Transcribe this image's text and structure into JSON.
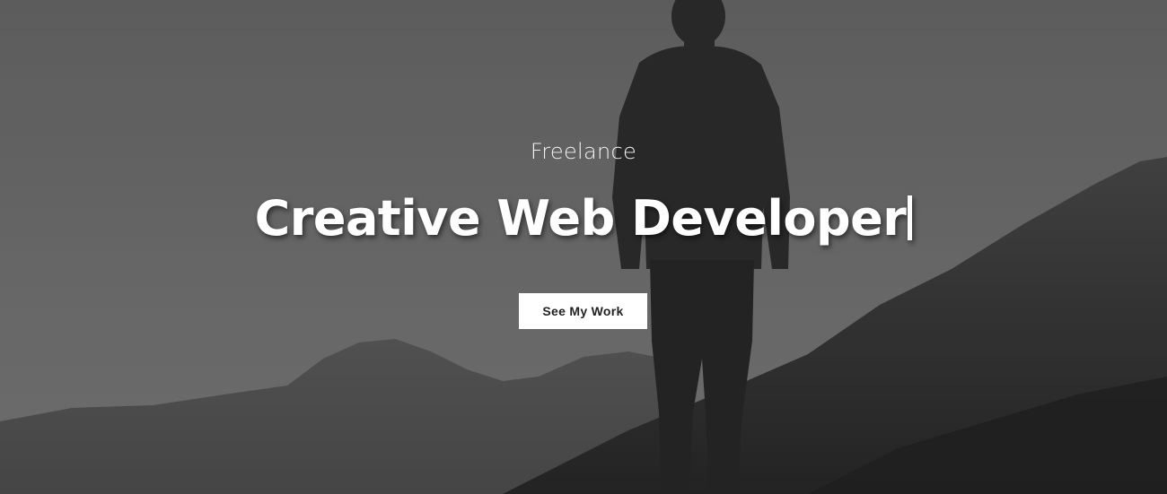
{
  "hero": {
    "subtitle": "Freelance",
    "headline": "Creative Web Developer",
    "cta_label": "See My Work"
  },
  "colors": {
    "overlay": "#6b6b6b",
    "text": "#ffffff",
    "button_bg": "#ffffff",
    "button_text": "#222222"
  }
}
